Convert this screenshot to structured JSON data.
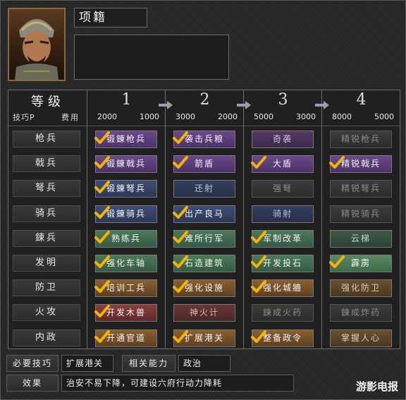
{
  "character": {
    "name": "项籍"
  },
  "header": {
    "title": "等级",
    "sub_left": "技巧P",
    "sub_right": "费用",
    "levels": [
      {
        "num": "1",
        "cost_a": "2000",
        "cost_b": "1000"
      },
      {
        "num": "2",
        "cost_a": "3000",
        "cost_b": "2000"
      },
      {
        "num": "3",
        "cost_a": "5000",
        "cost_b": "3000"
      },
      {
        "num": "4",
        "cost_a": "8000",
        "cost_b": "5000"
      }
    ]
  },
  "rows": [
    {
      "category": "枪兵",
      "skills": [
        {
          "label": "锻錬枪兵",
          "color": "purple",
          "checked": true
        },
        {
          "label": "袭击兵粮",
          "color": "purple",
          "checked": true
        },
        {
          "label": "奇袭",
          "color": "dpurple",
          "checked": false
        },
        {
          "label": "精锐枪兵",
          "color": "gray",
          "checked": false
        }
      ]
    },
    {
      "category": "戟兵",
      "skills": [
        {
          "label": "锻錬戟兵",
          "color": "purple",
          "checked": true
        },
        {
          "label": "箭盾",
          "color": "purple",
          "checked": true
        },
        {
          "label": "大盾",
          "color": "purple",
          "checked": true
        },
        {
          "label": "精锐戟兵",
          "color": "purple",
          "checked": true
        }
      ]
    },
    {
      "category": "弩兵",
      "skills": [
        {
          "label": "锻錬弩兵",
          "color": "blue",
          "checked": true
        },
        {
          "label": "还射",
          "color": "dblue",
          "checked": false
        },
        {
          "label": "强弩",
          "color": "gray",
          "checked": false
        },
        {
          "label": "精锐弩兵",
          "color": "gray",
          "checked": false
        }
      ]
    },
    {
      "category": "骑兵",
      "skills": [
        {
          "label": "锻錬骑兵",
          "color": "blue",
          "checked": true
        },
        {
          "label": "出产良马",
          "color": "blue",
          "checked": true
        },
        {
          "label": "骑射",
          "color": "dblue",
          "checked": false
        },
        {
          "label": "精锐骑兵",
          "color": "gray",
          "checked": false
        }
      ]
    },
    {
      "category": "鍊兵",
      "skills": [
        {
          "label": "熟练兵",
          "color": "green",
          "checked": true
        },
        {
          "label": "难所行军",
          "color": "green",
          "checked": true
        },
        {
          "label": "军制改革",
          "color": "green",
          "checked": true
        },
        {
          "label": "云梯",
          "color": "dgreen",
          "checked": false
        }
      ]
    },
    {
      "category": "发明",
      "skills": [
        {
          "label": "强化车轴",
          "color": "green",
          "checked": true
        },
        {
          "label": "石造建筑",
          "color": "green",
          "checked": true
        },
        {
          "label": "开发投石",
          "color": "green",
          "checked": true
        },
        {
          "label": "霹雳",
          "color": "bgreen",
          "checked": true
        }
      ]
    },
    {
      "category": "防卫",
      "skills": [
        {
          "label": "培训工兵",
          "color": "orange",
          "checked": true
        },
        {
          "label": "强化设施",
          "color": "orange",
          "checked": true
        },
        {
          "label": "强化城牆",
          "color": "orange",
          "checked": true
        },
        {
          "label": "强化防卫",
          "color": "dorange",
          "checked": false
        }
      ]
    },
    {
      "category": "火攻",
      "skills": [
        {
          "label": "开发木兽",
          "color": "red",
          "checked": true
        },
        {
          "label": "神火计",
          "color": "dred",
          "checked": false
        },
        {
          "label": "鍊成火药",
          "color": "gray",
          "checked": false
        },
        {
          "label": "鍊成炸药",
          "color": "gray",
          "checked": false
        }
      ]
    },
    {
      "category": "内政",
      "skills": [
        {
          "label": "开通官道",
          "color": "orange",
          "checked": true
        },
        {
          "label": "扩展港关",
          "color": "orange",
          "checked": true
        },
        {
          "label": "整备政令",
          "color": "orange",
          "checked": true
        },
        {
          "label": "掌握人心",
          "color": "dorange",
          "checked": false
        }
      ]
    }
  ],
  "footer": {
    "required_label": "必要技巧",
    "required_value": "扩展港关",
    "ability_label": "相关能力",
    "ability_value": "政治",
    "effect_label": "效果",
    "effect_value": "治安不易下降，可建设六府行动力降耗"
  },
  "watermark": "游影电报",
  "colors": {
    "checkmark": "#f2b400",
    "border": "#6e6e6e"
  }
}
